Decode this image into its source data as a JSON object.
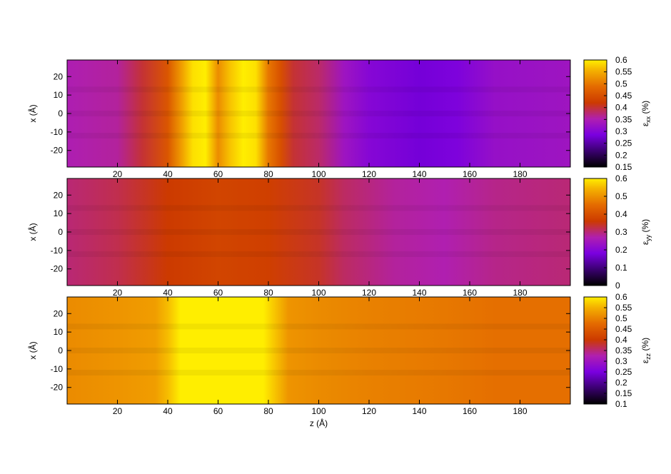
{
  "chart_data": [
    {
      "type": "heatmap",
      "id": "exx",
      "xlabel": "",
      "ylabel": "x (Å)",
      "xlim": [
        0,
        200
      ],
      "ylim": [
        -29,
        29
      ],
      "x_ticks": [
        "20",
        "40",
        "60",
        "80",
        "100",
        "120",
        "140",
        "160",
        "180"
      ],
      "y_ticks": [
        "20",
        "10",
        "0",
        "-10",
        "-20"
      ],
      "colorbar": {
        "label_main": "ε",
        "label_sub": "xx",
        "label_unit": " (%)",
        "range": [
          0.15,
          0.6
        ],
        "ticks": [
          "0.6",
          "0.55",
          "0.5",
          "0.45",
          "0.4",
          "0.35",
          "0.3",
          "0.25",
          "0.2",
          "0.15"
        ]
      },
      "z_profile": {
        "z": [
          0,
          20,
          30,
          40,
          45,
          50,
          55,
          60,
          65,
          70,
          75,
          80,
          85,
          90,
          100,
          110,
          120,
          140,
          155,
          170,
          200
        ],
        "value": [
          0.35,
          0.36,
          0.4,
          0.46,
          0.53,
          0.59,
          0.6,
          0.52,
          0.57,
          0.6,
          0.59,
          0.5,
          0.45,
          0.4,
          0.38,
          0.33,
          0.3,
          0.28,
          0.29,
          0.32,
          0.33
        ]
      }
    },
    {
      "type": "heatmap",
      "id": "eyy",
      "xlabel": "",
      "ylabel": "x (Å)",
      "xlim": [
        0,
        200
      ],
      "ylim": [
        -29,
        29
      ],
      "x_ticks": [
        "20",
        "40",
        "60",
        "80",
        "100",
        "120",
        "140",
        "160",
        "180"
      ],
      "y_ticks": [
        "20",
        "10",
        "0",
        "-10",
        "-20"
      ],
      "colorbar": {
        "label_main": "ε",
        "label_sub": "yy",
        "label_unit": " (%)",
        "range": [
          0.0,
          0.6
        ],
        "ticks": [
          "0.6",
          "0.5",
          "0.4",
          "0.3",
          "0.2",
          "0.1",
          "0"
        ]
      },
      "z_profile": {
        "z": [
          0,
          20,
          40,
          60,
          80,
          100,
          110,
          130,
          150,
          170,
          200
        ],
        "value": [
          0.3,
          0.32,
          0.36,
          0.38,
          0.37,
          0.34,
          0.31,
          0.28,
          0.27,
          0.29,
          0.3
        ]
      }
    },
    {
      "type": "heatmap",
      "id": "ezz",
      "xlabel": "z (Å)",
      "ylabel": "x (Å)",
      "xlim": [
        0,
        200
      ],
      "ylim": [
        -29,
        29
      ],
      "x_ticks": [
        "20",
        "40",
        "60",
        "80",
        "100",
        "120",
        "140",
        "160",
        "180"
      ],
      "y_ticks": [
        "20",
        "10",
        "0",
        "-10",
        "-20"
      ],
      "colorbar": {
        "label_main": "ε",
        "label_sub": "zz",
        "label_unit": " (%)",
        "range": [
          0.1,
          0.6
        ],
        "ticks": [
          "0.6",
          "0.55",
          "0.5",
          "0.45",
          "0.4",
          "0.35",
          "0.3",
          "0.25",
          "0.2",
          "0.15",
          "0.1"
        ]
      },
      "z_profile": {
        "z": [
          0,
          20,
          35,
          40,
          45,
          60,
          78,
          82,
          88,
          100,
          120,
          150,
          170,
          200
        ],
        "value": [
          0.51,
          0.52,
          0.53,
          0.56,
          0.6,
          0.6,
          0.6,
          0.57,
          0.52,
          0.51,
          0.5,
          0.49,
          0.48,
          0.48
        ]
      }
    }
  ]
}
